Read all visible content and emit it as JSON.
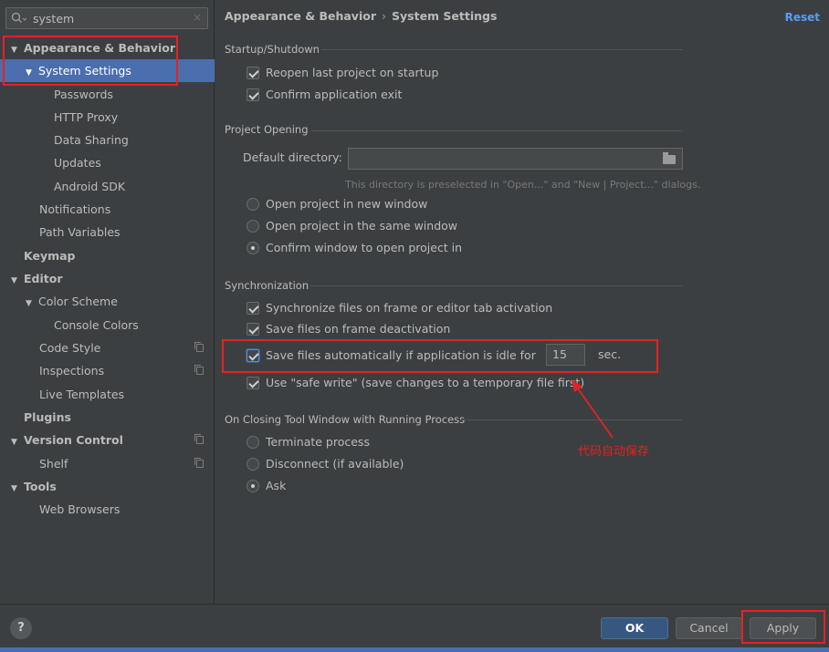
{
  "search": {
    "value": "system",
    "clear": "×"
  },
  "sidebar": {
    "items": [
      {
        "label": "Appearance & Behavior",
        "arrow": "▼"
      },
      {
        "label": "System Settings",
        "arrow": "▼"
      },
      {
        "label": "Passwords"
      },
      {
        "label": "HTTP Proxy"
      },
      {
        "label": "Data Sharing"
      },
      {
        "label": "Updates"
      },
      {
        "label": "Android SDK"
      },
      {
        "label": "Notifications"
      },
      {
        "label": "Path Variables"
      },
      {
        "label": "Keymap"
      },
      {
        "label": "Editor",
        "arrow": "▼"
      },
      {
        "label": "Color Scheme",
        "arrow": "▼"
      },
      {
        "label": "Console Colors"
      },
      {
        "label": "Code Style"
      },
      {
        "label": "Inspections"
      },
      {
        "label": "Live Templates"
      },
      {
        "label": "Plugins"
      },
      {
        "label": "Version Control",
        "arrow": "▼"
      },
      {
        "label": "Shelf"
      },
      {
        "label": "Tools",
        "arrow": "▼"
      },
      {
        "label": "Web Browsers"
      }
    ]
  },
  "header": {
    "crumb1": "Appearance & Behavior",
    "sep": "›",
    "crumb2": "System Settings",
    "reset": "Reset"
  },
  "startup": {
    "title": "Startup/Shutdown",
    "reopen": "Reopen last project on startup",
    "confirm_exit": "Confirm application exit"
  },
  "project_opening": {
    "title": "Project Opening",
    "default_dir_label": "Default directory:",
    "default_dir_value": "",
    "hint": "This directory is preselected in \"Open...\" and \"New | Project...\" dialogs.",
    "new_window": "Open project in new window",
    "same_window": "Open project in the same window",
    "confirm_window": "Confirm window to open project in"
  },
  "sync": {
    "title": "Synchronization",
    "sync_files": "Synchronize files on frame or editor tab activation",
    "save_deactivation": "Save files on frame deactivation",
    "save_idle": "Save files automatically if application is idle for",
    "idle_value": "15",
    "idle_unit": "sec.",
    "safe_write": "Use \"safe write\" (save changes to a temporary file first)"
  },
  "closing": {
    "title": "On Closing Tool Window with Running Process",
    "terminate": "Terminate process",
    "disconnect": "Disconnect (if available)",
    "ask": "Ask"
  },
  "annotation": {
    "text": "代码自动保存"
  },
  "footer": {
    "help": "?",
    "ok": "OK",
    "cancel": "Cancel",
    "apply": "Apply"
  },
  "colors": {
    "accent": "#4b6eaf",
    "link": "#589df6",
    "annotation": "#e52222",
    "background": "#3c3f41"
  }
}
